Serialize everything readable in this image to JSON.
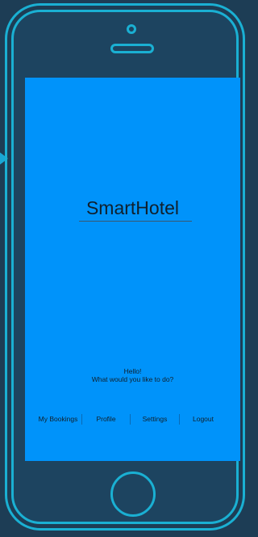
{
  "app": {
    "title": "SmartHotel"
  },
  "greeting": {
    "line1": "Hello!",
    "line2": "What would you like to do?"
  },
  "nav": {
    "items": [
      {
        "label": "My Bookings"
      },
      {
        "label": "Profile"
      },
      {
        "label": "Settings"
      },
      {
        "label": "Logout"
      }
    ]
  },
  "colors": {
    "page_background": "#1d3d55",
    "device_outline": "#1ab0d3",
    "device_body": "#1d4460",
    "screen_background": "#0093fa",
    "text": "#10202c"
  },
  "icons": {
    "side_arrow": "triangle-right-icon",
    "camera": "camera-icon",
    "speaker": "speaker-icon",
    "home_button": "home-button-icon"
  }
}
